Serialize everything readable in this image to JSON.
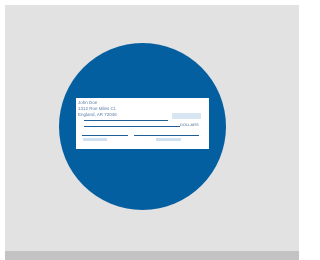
{
  "colors": {
    "background": "#e2e2e2",
    "bottom_bar": "#c3c3c3",
    "circle": "#045fa0",
    "check": "#ffffff",
    "check_lines": "#1f5f96",
    "check_text": "#5a7fa8"
  },
  "icons": {
    "check": "bank-check-icon"
  },
  "check": {
    "name": "John Doe",
    "address_line": "1312 Roe Miles Ct.",
    "city_line": "England, AR 72046",
    "dollars_label": "DOLLARS"
  }
}
